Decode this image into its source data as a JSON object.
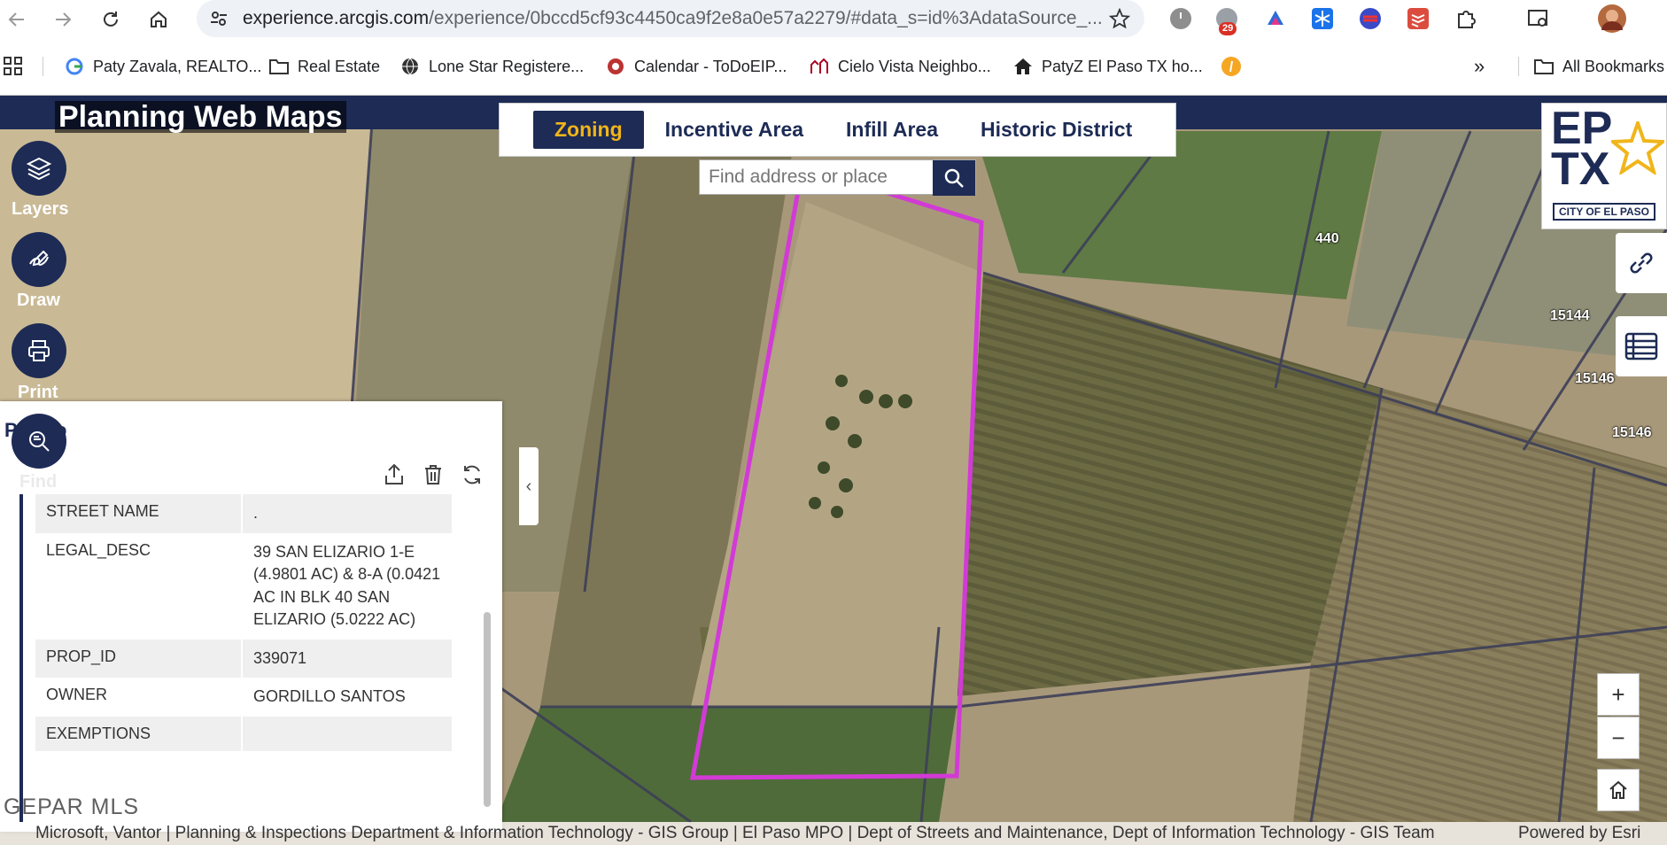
{
  "browser": {
    "url_main": "experience.arcgis.com",
    "url_rest": "/experience/0bccd5cf93c4450ca9f2e8a0e57a2279/#data_s=id%3AdataSource_...",
    "ext_badge": "29",
    "bookmarks": [
      {
        "label": "Paty Zavala, REALTO...",
        "icon": "google-icon"
      },
      {
        "label": "Real Estate",
        "icon": "folder-icon"
      },
      {
        "label": "Lone Star Registere...",
        "icon": "globe-icon"
      },
      {
        "label": "Calendar - ToDoEIP...",
        "icon": "calendar-icon"
      },
      {
        "label": "Cielo Vista Neighbo...",
        "icon": "neighborhood-icon"
      },
      {
        "label": "PatyZ El Paso TX ho...",
        "icon": "home-icon"
      }
    ],
    "all_bookmarks": "All Bookmarks",
    "overflow": "»"
  },
  "app": {
    "title": "Planning Web Maps",
    "tabs": [
      "Zoning",
      "Incentive Area",
      "Infill Area",
      "Historic District"
    ],
    "search_placeholder": "Find address or place",
    "logo_top": "EP",
    "logo_mid": "TX",
    "logo_caption": "CITY OF EL PASO",
    "side_buttons": {
      "layers": "Layers",
      "draw": "Draw",
      "print": "Print",
      "find": "Find"
    }
  },
  "map_labels": [
    "440",
    "15144",
    "15146",
    "15146"
  ],
  "panel": {
    "title": "P...Info",
    "rows": [
      {
        "key": "STREET NAME",
        "value": "."
      },
      {
        "key": "LEGAL_DESC",
        "value": "39 SAN ELIZARIO 1-E (4.9801 AC) & 8-A (0.0421 AC IN BLK 40 SAN ELIZARIO (5.0222 AC)"
      },
      {
        "key": "PROP_ID",
        "value": "339071"
      },
      {
        "key": "OWNER",
        "value": "GORDILLO SANTOS"
      },
      {
        "key": "EXEMPTIONS",
        "value": ""
      }
    ]
  },
  "attribution": "Microsoft, Vantor | Planning & Inspections Department & Information Technology - GIS Group | El Paso MPO | Dept of Streets and Maintenance, Dept of Information Technology - GIS Team",
  "esri": "Powered by Esri",
  "watermark": "GEPAR MLS",
  "colors": {
    "brand": "#1d2b55",
    "accent": "#f0b51a",
    "parcel": "#d23ad6"
  }
}
